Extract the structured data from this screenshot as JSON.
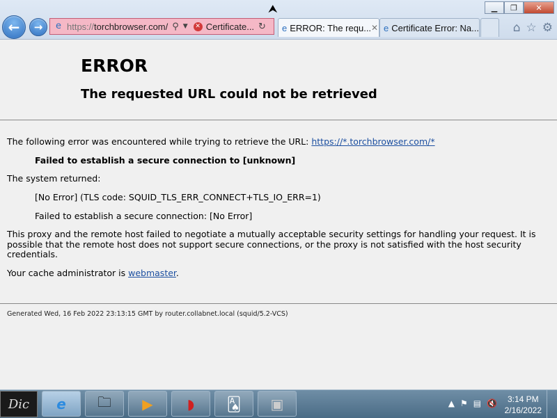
{
  "browser": {
    "address_url": "https://torchbrowser.com/",
    "address_scheme": "https://",
    "address_host": "torchbrowser.com/",
    "cert_label": "Certificate...",
    "tabs": [
      {
        "label": "ERROR: The requ..."
      },
      {
        "label": "Certificate Error: Na..."
      }
    ]
  },
  "page": {
    "title": "ERROR",
    "subtitle": "The requested URL could not be retrieved",
    "intro": "The following error was encountered while trying to retrieve the URL: ",
    "intro_link": "https://*.torchbrowser.com/*",
    "failed_line": "Failed to establish a secure connection to [unknown]",
    "system_returned": "The system returned:",
    "tls_line": "[No Error] (TLS code: SQUID_TLS_ERR_CONNECT+TLS_IO_ERR=1)",
    "failed_secure": "Failed to establish a secure connection: [No Error]",
    "paragraph": "This proxy and the remote host failed to negotiate a mutually acceptable security settings for handling your request. It is possible that the remote host does not support secure connections, or the proxy is not satisfied with the host security credentials.",
    "admin_prefix": "Your cache administrator is ",
    "admin_link": "webmaster",
    "admin_suffix": ".",
    "footer": "Generated Wed, 16 Feb 2022 23:13:15 GMT by router.collabnet.local (squid/5.2-VCS)"
  },
  "taskbar": {
    "start_label": "Dic",
    "time": "3:14 PM",
    "date": "2/16/2022"
  },
  "colors": {
    "address_error_bg": "#f5b8c6",
    "link": "#1c4fa0",
    "taskbar": "#4a6b85"
  }
}
